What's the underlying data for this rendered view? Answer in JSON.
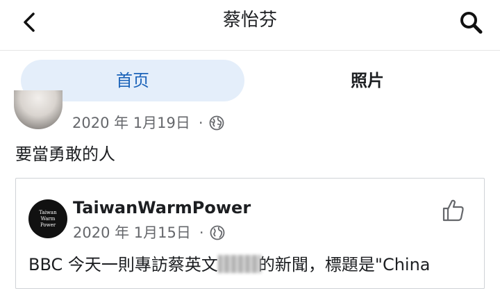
{
  "header": {
    "back_icon": "chevron-left-icon",
    "title": "蔡怡芬",
    "search_icon": "search-icon"
  },
  "tabs": [
    {
      "label": "首页",
      "selected": true
    },
    {
      "label": "照片",
      "selected": false
    }
  ],
  "post": {
    "date": "2020 年 1月19日",
    "separator": "·",
    "privacy_icon": "globe-icon",
    "text": "要當勇敢的人"
  },
  "shared_post": {
    "avatar_text_1": "Taiwan",
    "avatar_text_2": "Warm",
    "avatar_text_3": "Power",
    "author": "TaiwanWarmPower",
    "date": "2020 年 1月15日",
    "separator": "·",
    "privacy_icon": "globe-icon",
    "like_icon": "thumbs-up-icon",
    "text_before": "BBC 今天一則專訪蔡英文",
    "text_after": "的新聞，標題是\"China"
  },
  "colors": {
    "accent": "#1b63b9",
    "tab_selected_bg": "#e4eefa",
    "meta_text": "#65676b"
  }
}
